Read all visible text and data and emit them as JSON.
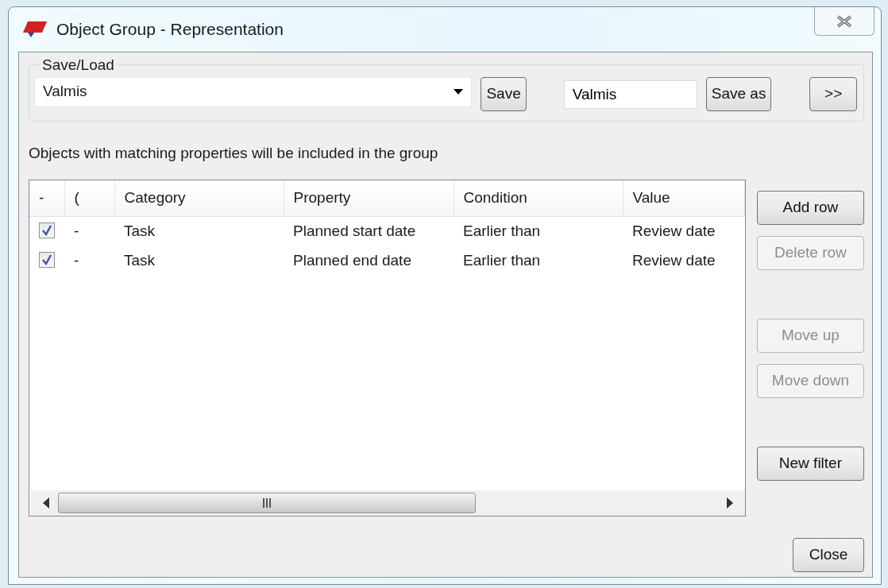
{
  "window": {
    "title": "Object Group - Representation"
  },
  "save_load": {
    "legend": "Save/Load",
    "preset": "Valmis",
    "save_button": "Save",
    "name_field": "Valmis",
    "save_as_button": "Save as",
    "more_button": ">>"
  },
  "hint": "Objects with matching properties will be included in the group",
  "table": {
    "columns": [
      "-",
      "(",
      "Category",
      "Property",
      "Condition",
      "Value"
    ],
    "rows": [
      {
        "checked": true,
        "cells": [
          "",
          "-",
          "Task",
          "Planned start date",
          "Earlier than",
          "Review date"
        ]
      },
      {
        "checked": true,
        "cells": [
          "",
          "-",
          "Task",
          "Planned end date",
          "Earlier than",
          "Review date"
        ]
      }
    ]
  },
  "side_buttons": [
    {
      "label": "Add row",
      "disabled": false
    },
    {
      "label": "Delete row",
      "disabled": true
    },
    {
      "label": "Move up",
      "disabled": true
    },
    {
      "label": "Move down",
      "disabled": true
    },
    {
      "label": "New filter",
      "disabled": false
    }
  ],
  "close_button": "Close"
}
